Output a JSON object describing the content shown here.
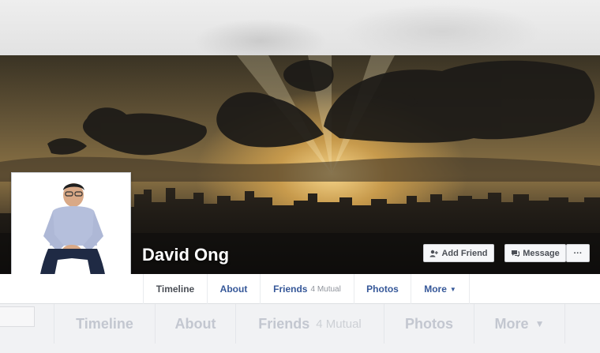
{
  "profile": {
    "name": "David Ong"
  },
  "actions": {
    "add_friend": "Add Friend",
    "message": "Message",
    "more": "···"
  },
  "nav": {
    "tabs": [
      {
        "label": "Timeline",
        "active": true
      },
      {
        "label": "About"
      },
      {
        "label": "Friends",
        "sub": "4 Mutual"
      },
      {
        "label": "Photos"
      },
      {
        "label": "More",
        "caret": "▼"
      }
    ]
  },
  "colors": {
    "link": "#365899",
    "active_tab": "#4b4f56"
  },
  "icons": {
    "add_friend": "add-friend-icon",
    "message": "message-icon"
  }
}
